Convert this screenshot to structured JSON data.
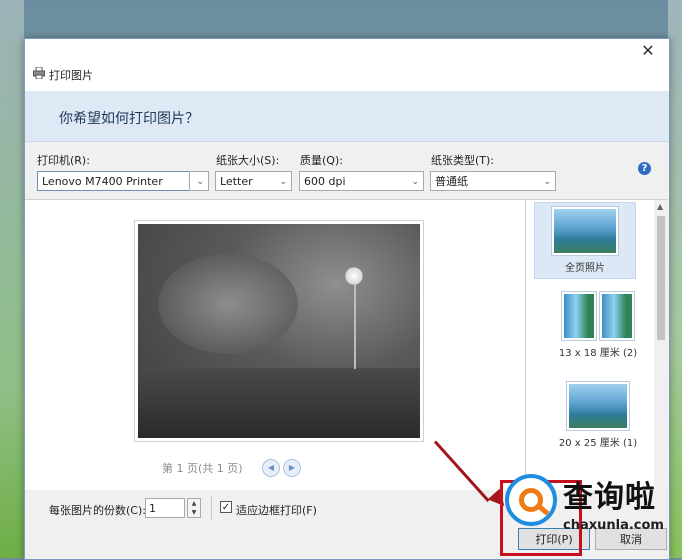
{
  "window": {
    "title": "打印图片",
    "close_glyph": "✕"
  },
  "header": {
    "question": "你希望如何打印图片？"
  },
  "options": {
    "printer_label": "打印机(R):",
    "printer_value": "Lenovo M7400 Printer",
    "paper_size_label": "纸张大小(S):",
    "paper_size_value": "Letter",
    "quality_label": "质量(Q):",
    "quality_value": "600 dpi",
    "paper_type_label": "纸张类型(T):",
    "paper_type_value": "普通纸",
    "help_glyph": "?"
  },
  "preview": {
    "page_indicator": "第 1 页(共 1 页)",
    "prev_glyph": "◀",
    "next_glyph": "▶"
  },
  "layouts": [
    {
      "label": "全页照片",
      "selected": true
    },
    {
      "label": "13 x 18 厘米 (2)",
      "selected": false
    },
    {
      "label": "20 x 25 厘米 (1)",
      "selected": false
    }
  ],
  "bottom": {
    "copies_label": "每张图片的份数(C):",
    "copies_value": "1",
    "spin_up": "▲",
    "spin_down": "▼",
    "fit_checked": "✓",
    "fit_label": "适应边框打印(F)",
    "print_button": "打印(P)",
    "cancel_button": "取消"
  },
  "watermark": {
    "brand": "查询啦",
    "domain": "chaxunla.com"
  },
  "colors": {
    "accent": "#2d6cc0",
    "highlight": "#c8101e",
    "header_bg": "#dfe9f5"
  }
}
